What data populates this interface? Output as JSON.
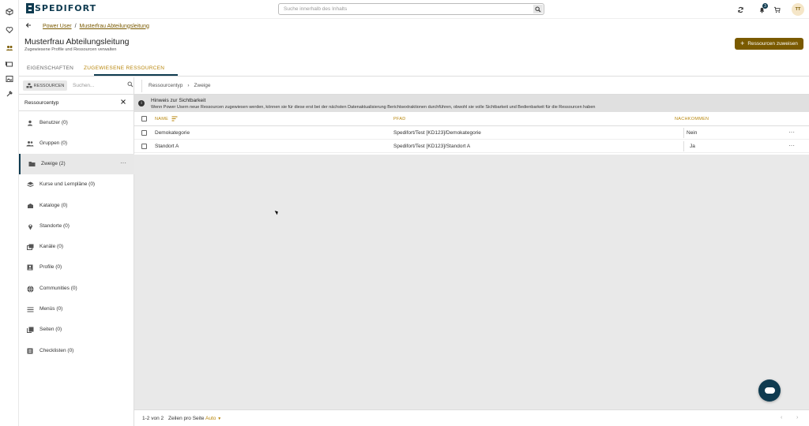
{
  "app": {
    "logo_text": "SPEDIFORT"
  },
  "search": {
    "placeholder": "Suche innerhalb des Inhalts"
  },
  "header": {
    "notifications_count": "3",
    "avatar_initials": "TT"
  },
  "breadcrumb": {
    "items": [
      "Power User",
      "/",
      "Musterfrau Abteilungsleitung"
    ]
  },
  "page": {
    "title": "Musterfrau Abteilungsleitung",
    "subtitle": "Zugewiesene Profile und Ressourcen verwalten",
    "assign_button": "Ressourcen zuweisen"
  },
  "tabs": [
    {
      "label": "EIGENSCHAFTEN",
      "active": false
    },
    {
      "label": "ZUGEWIESENE RESSOURCEN",
      "active": true
    }
  ],
  "left": {
    "resources_button": "RESSOURCEN",
    "search_placeholder": "Suchen...",
    "header": "Ressourcentyp",
    "items": [
      {
        "label": "Benutzer (0)",
        "icon": "person-icon"
      },
      {
        "label": "Gruppen (0)",
        "icon": "group-icon"
      },
      {
        "label": "Zweige (2)",
        "icon": "folder-icon",
        "selected": true
      },
      {
        "label": "Kurse und Lernpläne (0)",
        "icon": "layers-icon"
      },
      {
        "label": "Kataloge (0)",
        "icon": "catalog-icon"
      },
      {
        "label": "Standorte (0)",
        "icon": "location-icon"
      },
      {
        "label": "Kanäle (0)",
        "icon": "channel-icon"
      },
      {
        "label": "Profile (0)",
        "icon": "profile-icon"
      },
      {
        "label": "Communities (0)",
        "icon": "globe-icon"
      },
      {
        "label": "Menüs (0)",
        "icon": "menu-icon"
      },
      {
        "label": "Seiten (0)",
        "icon": "pages-icon"
      },
      {
        "label": "Checklisten (0)",
        "icon": "checklist-icon"
      }
    ]
  },
  "main": {
    "crumb": [
      "Ressourcentyp",
      "›",
      "Zweige"
    ],
    "notice": {
      "title": "Hinweis zur Sichtbarkeit",
      "body": "Wenn Power Usern neue Ressourcen zugewiesen werden, können sie für diese erst bei der nächsten Datenaktualisierung Berichtsextraktionen durchführen, obwohl sie volle Sichtbarkeit und Bedienbarkeit für die Ressourcen haben"
    },
    "columns": [
      "NAME",
      "PFAD",
      "NACHKOMMEN"
    ],
    "rows": [
      {
        "name": "Demokategorie",
        "path": "Spedifort/Test [KD123]/Demokategorie",
        "descendants": "Nein"
      },
      {
        "name": "Standort A",
        "path": "Spedifort/Test [KD123]/Standort A",
        "descendants": "Ja"
      }
    ],
    "footer": {
      "range": "1-2 von 2",
      "rows_label": "Zeilen pro Seite",
      "rows_value": "Auto"
    }
  },
  "colors": {
    "accent": "#7a5a00",
    "brand": "#0f3b50",
    "highlight": "#b8860b"
  }
}
